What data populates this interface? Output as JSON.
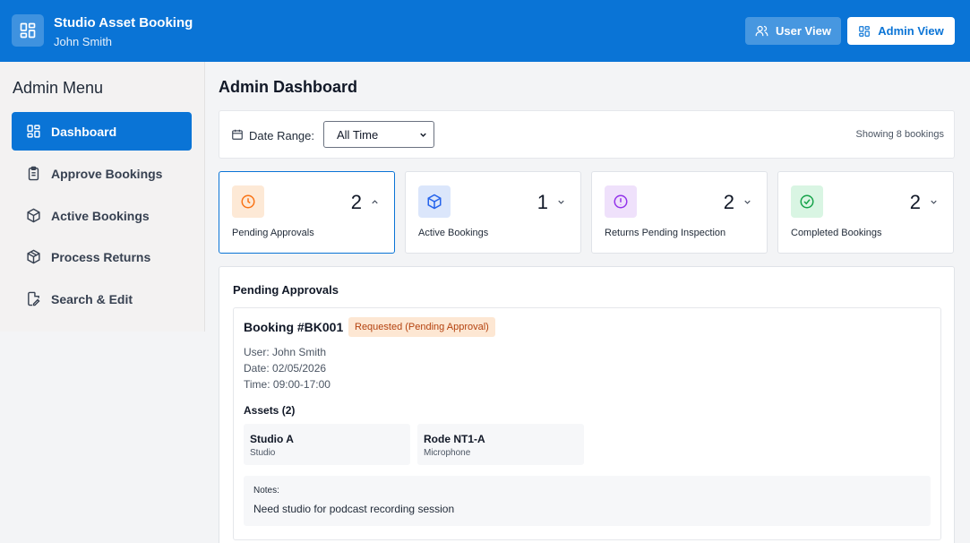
{
  "header": {
    "app_title": "Studio Asset Booking",
    "user_name": "John Smith",
    "user_view_label": "User View",
    "admin_view_label": "Admin View"
  },
  "sidebar": {
    "title": "Admin Menu",
    "items": [
      {
        "label": "Dashboard",
        "icon": "dashboard-grid-icon",
        "active": true
      },
      {
        "label": "Approve Bookings",
        "icon": "clipboard-icon",
        "active": false
      },
      {
        "label": "Active Bookings",
        "icon": "package-icon",
        "active": false
      },
      {
        "label": "Process Returns",
        "icon": "package-return-icon",
        "active": false
      },
      {
        "label": "Search & Edit",
        "icon": "file-edit-icon",
        "active": false
      }
    ]
  },
  "main": {
    "page_title": "Admin Dashboard",
    "filter": {
      "label": "Date Range:",
      "selected": "All Time",
      "showing": "Showing 8 bookings"
    },
    "stats": [
      {
        "count": "2",
        "label": "Pending Approvals",
        "icon": "clock-icon",
        "color": "#f97316",
        "bg": "#fde9d6",
        "expanded": true
      },
      {
        "count": "1",
        "label": "Active Bookings",
        "icon": "box-icon",
        "color": "#2563eb",
        "bg": "#dbe6fb",
        "expanded": false
      },
      {
        "count": "2",
        "label": "Returns Pending Inspection",
        "icon": "alert-circle-icon",
        "color": "#9333ea",
        "bg": "#efe1fb",
        "expanded": false
      },
      {
        "count": "2",
        "label": "Completed Bookings",
        "icon": "check-circle-icon",
        "color": "#16a34a",
        "bg": "#d9f5e3",
        "expanded": false
      }
    ],
    "pending": {
      "section_title": "Pending Approvals",
      "booking": {
        "id": "Booking #BK001",
        "status": "Requested (Pending Approval)",
        "user": "User: John Smith",
        "date": "Date: 02/05/2026",
        "time": "Time: 09:00-17:00",
        "assets_title": "Assets (2)",
        "assets": [
          {
            "name": "Studio A",
            "type": "Studio"
          },
          {
            "name": "Rode NT1-A",
            "type": "Microphone"
          }
        ],
        "notes_label": "Notes:",
        "notes_text": "Need studio for podcast recording session"
      }
    }
  },
  "colors": {
    "primary": "#0a74d6",
    "badge_bg": "#fde7d3",
    "badge_text": "#b4420f"
  }
}
